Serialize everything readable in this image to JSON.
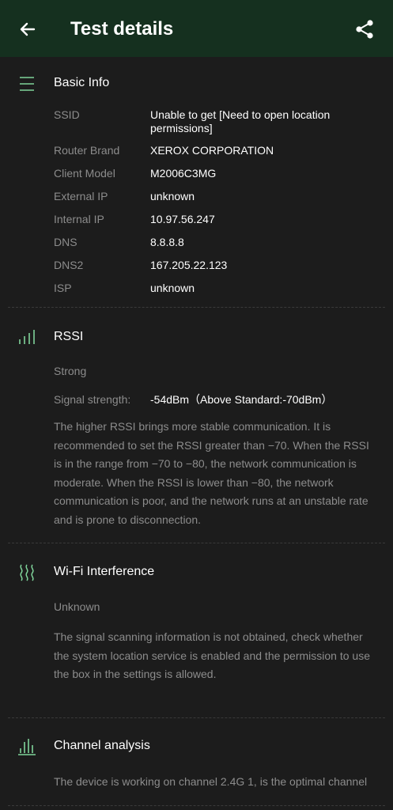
{
  "header": {
    "title": "Test details",
    "back_icon": "arrow-left-icon",
    "share_icon": "share-icon",
    "background": "#15301f"
  },
  "basic_info": {
    "title": "Basic Info",
    "icon": "menu-lines-icon",
    "rows": [
      {
        "label": "SSID",
        "value": "Unable to get [Need to open location permissions]"
      },
      {
        "label": "Router Brand",
        "value": "XEROX CORPORATION"
      },
      {
        "label": "Client Model",
        "value": "M2006C3MG"
      },
      {
        "label": "External IP",
        "value": "unknown"
      },
      {
        "label": "Internal IP",
        "value": "10.97.56.247"
      },
      {
        "label": "DNS",
        "value": "8.8.8.8"
      },
      {
        "label": "DNS2",
        "value": "167.205.22.123"
      },
      {
        "label": "ISP",
        "value": "unknown"
      }
    ]
  },
  "rssi": {
    "title": "RSSI",
    "icon": "signal-bars-icon",
    "status": "Strong",
    "signal_label": "Signal strength:",
    "signal_value": "-54dBm（Above Standard:-70dBm）",
    "description": "The higher RSSI brings more stable communication. It is recommended to set the RSSI greater than −70. When the RSSI is in the range from −70 to −80, the network communication is moderate. When the RSSI is lower than −80, the network communication is poor, and the network runs at an unstable rate and is prone to disconnection."
  },
  "interference": {
    "title": "Wi-Fi Interference",
    "icon": "wave-lines-icon",
    "status": "Unknown",
    "description": "The signal scanning information is not obtained, check whether the system location service is enabled and the permission to use the box in the settings is allowed."
  },
  "channel": {
    "title": "Channel analysis",
    "icon": "channel-bars-icon",
    "description": "The device is working on channel 2.4G 1, is the optimal channel"
  },
  "colors": {
    "accent": "#7fd39a",
    "background": "#1c1c1c",
    "muted_text": "#8c8c8c"
  }
}
